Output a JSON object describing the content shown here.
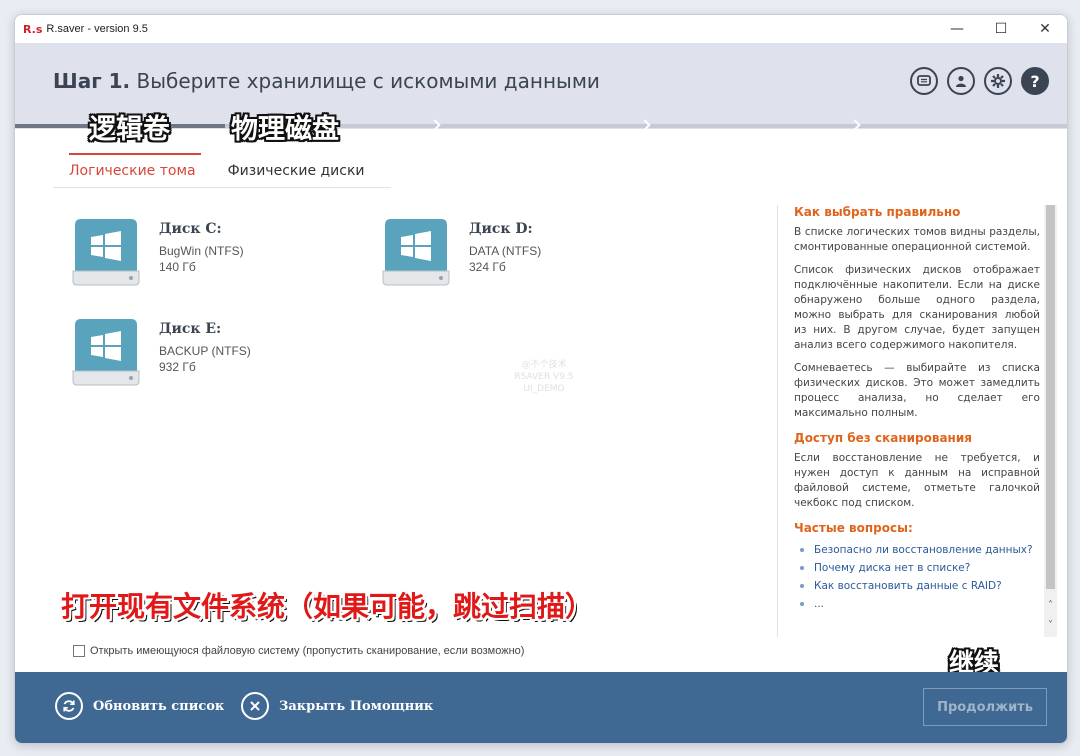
{
  "titlebar": {
    "logo": "R.s",
    "title": "R.saver - version 9.5",
    "minimize": "—",
    "maximize": "☐",
    "close": "✕"
  },
  "header": {
    "step_bold": "Шаг 1.",
    "step_text": "Выберите хранилище с искомыми данными",
    "icons": [
      "chat-icon",
      "user-icon",
      "gear-icon",
      "help-icon"
    ],
    "help_glyph": "?"
  },
  "captions": {
    "logical": "逻辑卷",
    "physical": "物理磁盘",
    "open_fs": "打开现有文件系统（如果可能，跳过扫描）",
    "continue": "继续"
  },
  "tabs": [
    {
      "label": "Логические тома",
      "active": true
    },
    {
      "label": "Физические диски",
      "active": false
    }
  ],
  "disks": [
    {
      "name": "Диск C:",
      "label": "BugWin (NTFS)",
      "size": "140 Гб"
    },
    {
      "name": "Диск D:",
      "label": "DATA (NTFS)",
      "size": "324 Гб"
    },
    {
      "name": "Диск E:",
      "label": "BACKUP (NTFS)",
      "size": "932 Гб"
    }
  ],
  "watermark": [
    "@不个技术",
    "RSAVER V9.5",
    "UI_DEMO"
  ],
  "sidebar": {
    "h1": "Как выбрать правильно",
    "p1": "В списке логических томов видны разделы, смонтированные операционной системой.",
    "p2": "Список физических дисков отображает подключённые накопители. Если на диске обнаружено больше одного раздела, можно выбрать для сканирования любой из них. В другом случае, будет запущен анализ всего содержимого накопителя.",
    "p3": "Сомневаетесь — выбирайте из списка физических дисков. Это может замедлить процесс анализа, но сделает его максимально полным.",
    "h2": "Доступ без сканирования",
    "p4": "Если восстановление не требуется, и нужен доступ к данным на исправной файловой системе, отметьте галочкой чекбокс под списком.",
    "h3": "Частые вопросы:",
    "faq": [
      "Безопасно ли восстановление данных?",
      "Почему диска нет в списке?",
      "Как восстановить данные с RAID?",
      "..."
    ]
  },
  "scroll": {
    "up": "˄",
    "down": "˅"
  },
  "checkbox": {
    "label": "Открыть имеющуюся файловую систему (пропустить сканирование, если возможно)",
    "checked": false
  },
  "footer": {
    "refresh": "Обновить список",
    "close": "Закрыть Помощник",
    "continue": "Продолжить"
  }
}
